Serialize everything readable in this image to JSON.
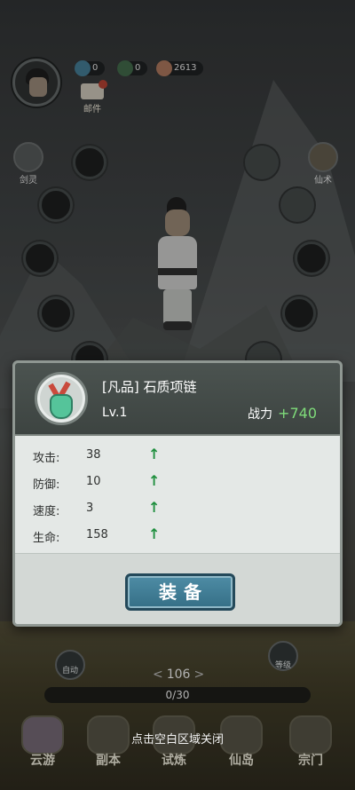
{
  "hud": {
    "resource1_value": "0",
    "resource2_value": "0",
    "resource3_value": "2613",
    "mail_label": "邮件",
    "side_left_label": "剑灵",
    "side_right_label": "仙术"
  },
  "item_panel": {
    "name": "[凡品] 石质项链",
    "level": "Lv.1",
    "power_label": "战力",
    "power_delta": "+740",
    "stats": [
      {
        "label": "攻击:",
        "value": "38"
      },
      {
        "label": "防御:",
        "value": "10"
      },
      {
        "label": "速度:",
        "value": "3"
      },
      {
        "label": "生命:",
        "value": "158"
      }
    ],
    "equip_label": "装备"
  },
  "battle": {
    "auto_label": "自动",
    "waitfor_label": "等级",
    "stage": "106",
    "progress_text": "0/30",
    "progress_fraction": 0.0
  },
  "close_hint": "点击空白区域关闭",
  "nav": [
    {
      "label": "云游"
    },
    {
      "label": "副本"
    },
    {
      "label": "试炼"
    },
    {
      "label": "仙岛"
    },
    {
      "label": "宗门"
    }
  ]
}
